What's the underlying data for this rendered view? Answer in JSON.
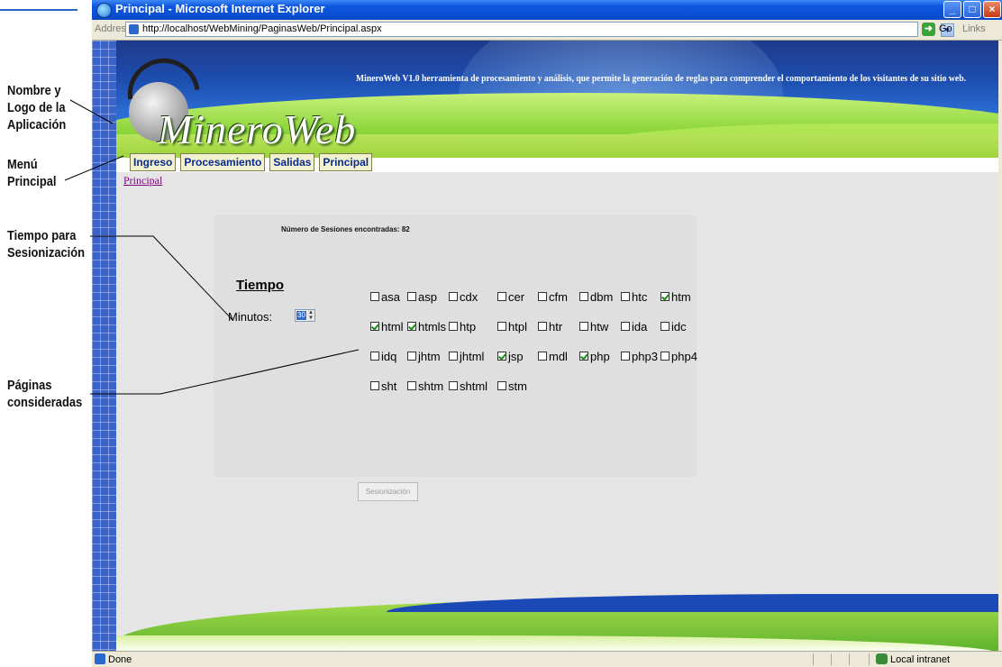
{
  "annotations": {
    "nombre_logo": [
      "Nombre y",
      "Logo de la",
      "Aplicación"
    ],
    "menu_principal": [
      "Menú",
      "Principal"
    ],
    "tiempo": [
      "Tiempo para",
      "Sesionización"
    ],
    "paginas": [
      "Páginas",
      "consideradas"
    ]
  },
  "window": {
    "title": "Principal - Microsoft Internet Explorer",
    "address_label": "Address",
    "url": "http://localhost/WebMining/PaginasWeb/Principal.aspx",
    "go_label": "Go",
    "links_label": "Links"
  },
  "banner": {
    "tagline": "MineroWeb V1.0 herramienta de procesamiento y análisis, que permite la generación de reglas para comprender el comportamiento de los visitantes de su sitio web.",
    "logo_text": "MineroWeb"
  },
  "menu": [
    "Ingreso",
    "Procesamiento",
    "Salidas",
    "Principal"
  ],
  "breadcrumb": "Principal",
  "sessions_text": "Número de Sesiones encontradas: 82",
  "tiempo": {
    "heading": "Tiempo",
    "minutes_label": "Minutos:",
    "minutes_value": "30"
  },
  "extensions": [
    {
      "label": "asa",
      "checked": false
    },
    {
      "label": "asp",
      "checked": false
    },
    {
      "label": "cdx",
      "checked": false
    },
    {
      "label": "cer",
      "checked": false
    },
    {
      "label": "cfm",
      "checked": false
    },
    {
      "label": "dbm",
      "checked": false
    },
    {
      "label": "htc",
      "checked": false
    },
    {
      "label": "htm",
      "checked": true
    },
    {
      "label": "html",
      "checked": true
    },
    {
      "label": "htmls",
      "checked": true
    },
    {
      "label": "htp",
      "checked": false
    },
    {
      "label": "htpl",
      "checked": false
    },
    {
      "label": "htr",
      "checked": false
    },
    {
      "label": "htw",
      "checked": false
    },
    {
      "label": "ida",
      "checked": false
    },
    {
      "label": "idc",
      "checked": false
    },
    {
      "label": "idq",
      "checked": false
    },
    {
      "label": "jhtm",
      "checked": false
    },
    {
      "label": "jhtml",
      "checked": false
    },
    {
      "label": "jsp",
      "checked": true
    },
    {
      "label": "mdl",
      "checked": false
    },
    {
      "label": "php",
      "checked": true
    },
    {
      "label": "php3",
      "checked": false
    },
    {
      "label": "php4",
      "checked": false
    },
    {
      "label": "sht",
      "checked": false
    },
    {
      "label": "shtm",
      "checked": false
    },
    {
      "label": "shtml",
      "checked": false
    },
    {
      "label": "stm",
      "checked": false
    }
  ],
  "button_label": "Sesionización",
  "status": {
    "left": "Done",
    "zone": "Local intranet"
  }
}
